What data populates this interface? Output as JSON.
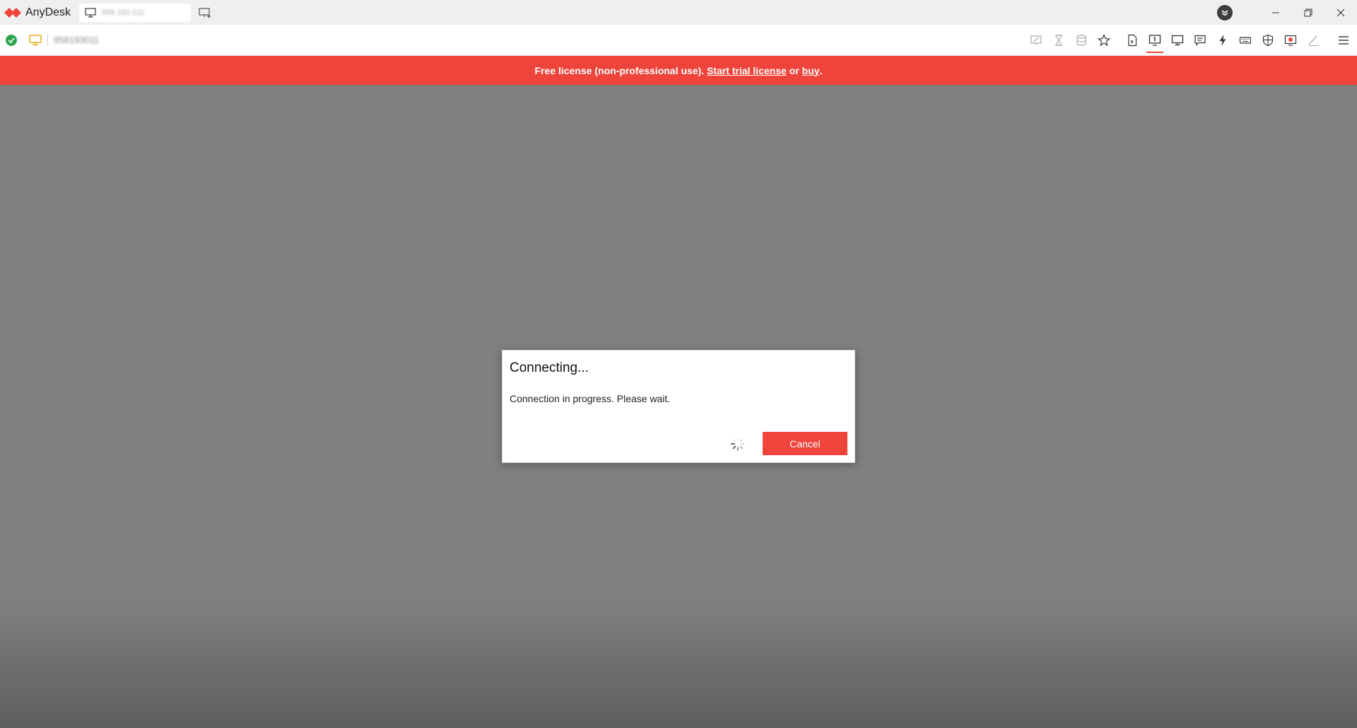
{
  "app": {
    "name": "AnyDesk"
  },
  "titlebar": {
    "tab_label": "958 193 011",
    "window_controls": [
      "minimize-icon",
      "restore-icon",
      "close-icon"
    ]
  },
  "toolbar": {
    "remote_id": "958193011",
    "icons": [
      "screen-annotate-icon",
      "hourglass-icon",
      "database-icon",
      "star-icon",
      "file-transfer-icon",
      "monitor-1-icon",
      "display-icon",
      "chat-icon",
      "lightning-icon",
      "keyboard-icon",
      "privacy-shield-icon",
      "record-icon",
      "pen-icon",
      "menu-icon"
    ],
    "active_icon": "monitor-1-icon"
  },
  "license_bar": {
    "text_prefix": "Free license (non-professional use). ",
    "trial_link": "Start trial license",
    "or_text": " or ",
    "buy_link": "buy",
    "suffix": "."
  },
  "dialog": {
    "title": "Connecting...",
    "message": "Connection in progress. Please wait.",
    "cancel_label": "Cancel"
  },
  "colors": {
    "accent": "#ef443b",
    "status_ok": "#2da44e",
    "remote_background": "#808080"
  }
}
